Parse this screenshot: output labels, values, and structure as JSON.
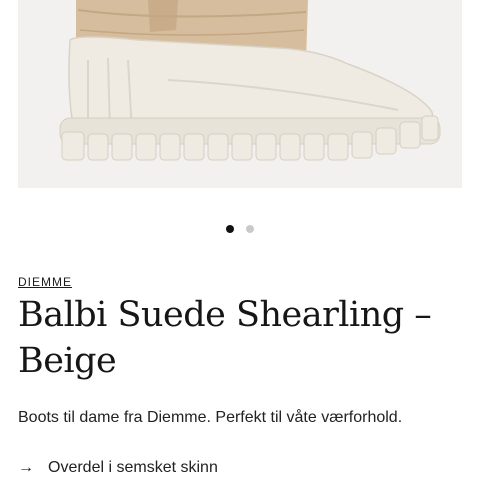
{
  "product": {
    "image": {
      "alt": "Beige suede shearling boot with white rubber sole"
    },
    "carousel": {
      "active_index": 0,
      "count": 2
    },
    "brand": "DIEMME",
    "title": "Balbi Suede Shearling – Beige",
    "description": "Boots til dame fra Diemme. Perfekt til våte værforhold.",
    "features": [
      {
        "icon": "arrow-right-icon",
        "text": "Overdel i semsket skinn"
      }
    ]
  },
  "colors": {
    "image_bg": "#f2f1ef",
    "suede": "#d6bd9d",
    "sole": "#efebe2",
    "dot_active": "#111111",
    "dot_inactive": "#c9c9c9"
  }
}
